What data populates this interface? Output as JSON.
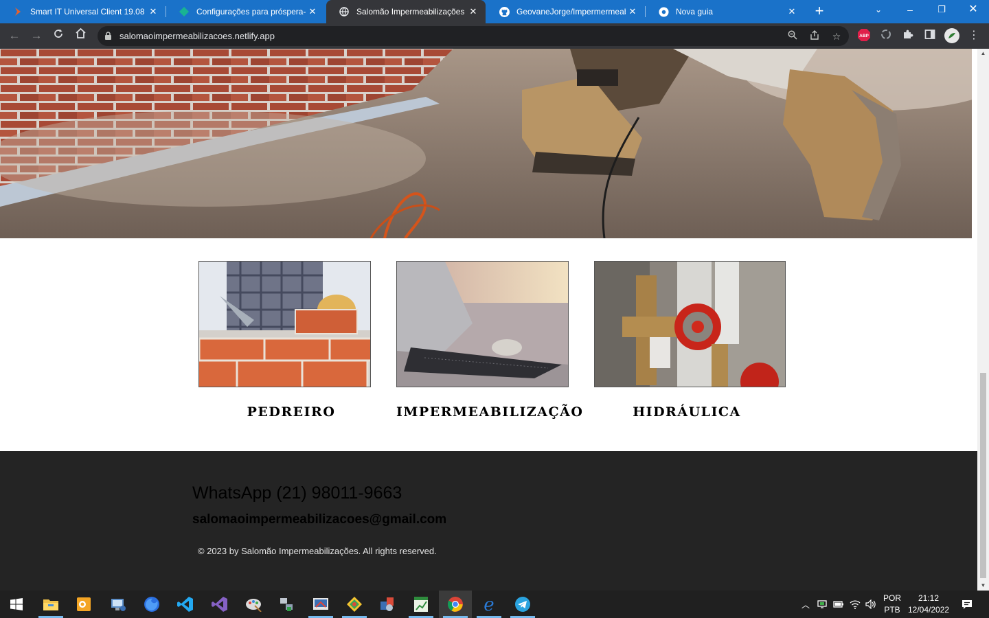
{
  "browser": {
    "tabs": [
      {
        "title": "Smart IT Universal Client 19.08",
        "icon": "smart-it-icon"
      },
      {
        "title": "Configurações para próspera-pi",
        "icon": "diamond-icon"
      },
      {
        "title": "Salomão Impermeabilizações",
        "icon": "globe-icon",
        "active": true
      },
      {
        "title": "GeovaneJorge/Impermermeabil",
        "icon": "github-icon"
      },
      {
        "title": "Nova guia",
        "icon": "chrome-icon"
      }
    ],
    "url": "salomaoimpermeabilizacoes.netlify.app",
    "extensions": {
      "adblock": "ABP"
    }
  },
  "page": {
    "services": [
      {
        "label": "PEDREIRO",
        "image": "bricklayer-photo"
      },
      {
        "label": "IMPERMEABILIZAÇÃO",
        "image": "waterproofing-photo"
      },
      {
        "label": "HIDRÁULICA",
        "image": "plumbing-valve-photo"
      }
    ],
    "footer": {
      "whatsapp": "WhatsApp (21) 98011-9663",
      "email": "salomaoimpermeabilizacoes@gmail.com",
      "copyright": "© 2023 by Salomão Impermeabilizações. All rights reserved."
    }
  },
  "taskbar": {
    "apps": [
      "file-explorer-icon",
      "outlook-icon",
      "remote-desktop-icon",
      "firefox-icon",
      "vscode-icon",
      "visual-studio-icon",
      "paint-icon",
      "network-icon",
      "snipping-icon",
      "git-icon",
      "office-icon",
      "excel-icon",
      "chrome-icon",
      "edge-icon",
      "telegram-icon"
    ],
    "language": {
      "line1": "POR",
      "line2": "PTB"
    },
    "time": "21:12",
    "date": "12/04/2022"
  },
  "colors": {
    "tabbar": "#1a72c9",
    "chrome_dark": "#35363a",
    "footer_bg": "#242424"
  }
}
